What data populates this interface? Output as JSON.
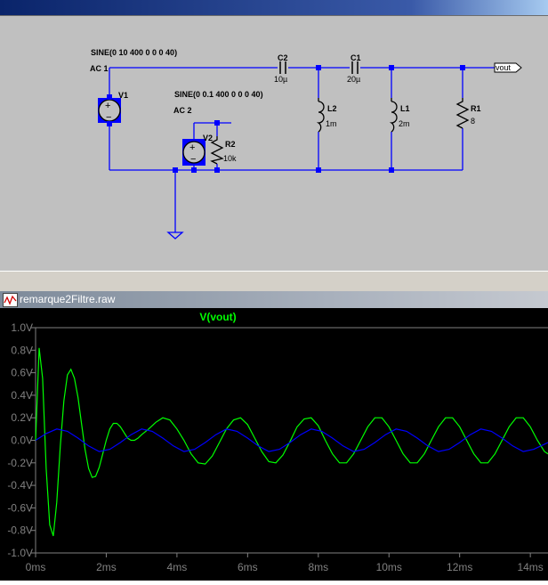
{
  "schematic": {
    "v1": {
      "name": "V1",
      "source": "SINE(0 10 400 0 0 0 40)",
      "ac": "AC 1"
    },
    "v2": {
      "name": "V2",
      "source": "SINE(0 0.1 400 0 0 0 40)",
      "ac": "AC 2"
    },
    "c2": {
      "name": "C2",
      "value": "10µ"
    },
    "c1": {
      "name": "C1",
      "value": "20µ"
    },
    "l2": {
      "name": "L2",
      "value": "1m"
    },
    "l1": {
      "name": "L1",
      "value": "2m"
    },
    "r1": {
      "name": "R1",
      "value": "8"
    },
    "r2": {
      "name": "R2",
      "value": "10k"
    },
    "net_label": "vout"
  },
  "plot_window": {
    "title": "remarque2Filtre.raw"
  },
  "chart_data": {
    "type": "line",
    "title": "",
    "xlabel": "",
    "ylabel": "",
    "x_unit": "ms",
    "xlim": [
      0,
      14.5
    ],
    "ylim": [
      -1.0,
      1.0
    ],
    "x_ticks": [
      "0ms",
      "2ms",
      "4ms",
      "6ms",
      "8ms",
      "10ms",
      "12ms",
      "14ms"
    ],
    "y_ticks": [
      "1.0V",
      "0.8V",
      "0.6V",
      "0.4V",
      "0.2V",
      "0.0V",
      "-0.2V",
      "-0.4V",
      "-0.6V",
      "-0.8V",
      "-1.0V"
    ],
    "series": [
      {
        "name": "V(vout)",
        "color": "#00ff00",
        "x": [
          0,
          0.1,
          0.2,
          0.3,
          0.4,
          0.5,
          0.6,
          0.7,
          0.8,
          0.9,
          1.0,
          1.1,
          1.2,
          1.3,
          1.4,
          1.5,
          1.6,
          1.7,
          1.8,
          1.9,
          2.0,
          2.1,
          2.2,
          2.3,
          2.4,
          2.5,
          2.6,
          2.7,
          2.8,
          2.9,
          3.0,
          3.2,
          3.4,
          3.6,
          3.8,
          4.0,
          4.2,
          4.4,
          4.6,
          4.8,
          5.0,
          5.2,
          5.4,
          5.6,
          5.8,
          6.0,
          6.2,
          6.4,
          6.6,
          6.8,
          7.0,
          7.2,
          7.4,
          7.6,
          7.8,
          8.0,
          8.2,
          8.4,
          8.6,
          8.8,
          9.0,
          9.2,
          9.4,
          9.6,
          9.8,
          10.0,
          10.2,
          10.4,
          10.6,
          10.8,
          11.0,
          11.2,
          11.4,
          11.6,
          11.8,
          12.0,
          12.2,
          12.4,
          12.6,
          12.8,
          13.0,
          13.2,
          13.4,
          13.6,
          13.8,
          14.0,
          14.2,
          14.4,
          14.5
        ],
        "y": [
          0.0,
          0.82,
          0.55,
          -0.25,
          -0.75,
          -0.85,
          -0.55,
          -0.05,
          0.35,
          0.58,
          0.63,
          0.55,
          0.38,
          0.15,
          -0.08,
          -0.25,
          -0.33,
          -0.32,
          -0.24,
          -0.12,
          0.0,
          0.1,
          0.15,
          0.15,
          0.12,
          0.07,
          0.02,
          0.0,
          0.0,
          0.02,
          0.05,
          0.1,
          0.16,
          0.2,
          0.18,
          0.1,
          0.0,
          -0.12,
          -0.2,
          -0.21,
          -0.14,
          -0.02,
          0.1,
          0.18,
          0.2,
          0.14,
          0.02,
          -0.1,
          -0.19,
          -0.2,
          -0.13,
          -0.01,
          0.12,
          0.19,
          0.2,
          0.13,
          0.0,
          -0.12,
          -0.2,
          -0.2,
          -0.12,
          0.0,
          0.12,
          0.2,
          0.2,
          0.12,
          0.0,
          -0.12,
          -0.2,
          -0.2,
          -0.12,
          0.0,
          0.12,
          0.2,
          0.2,
          0.12,
          0.0,
          -0.12,
          -0.2,
          -0.2,
          -0.12,
          0.0,
          0.12,
          0.2,
          0.2,
          0.12,
          0.0,
          -0.1,
          -0.12
        ]
      },
      {
        "name": "",
        "color": "#0000ff",
        "x": [
          0,
          0.3,
          0.6,
          0.9,
          1.2,
          1.5,
          1.8,
          2.1,
          2.4,
          2.7,
          3.0,
          3.3,
          3.6,
          3.9,
          4.2,
          4.5,
          4.8,
          5.1,
          5.4,
          5.7,
          6.0,
          6.3,
          6.6,
          6.9,
          7.2,
          7.5,
          7.8,
          8.1,
          8.4,
          8.7,
          9.0,
          9.3,
          9.6,
          9.9,
          10.2,
          10.5,
          10.8,
          11.1,
          11.4,
          11.7,
          12.0,
          12.3,
          12.6,
          12.9,
          13.2,
          13.5,
          13.8,
          14.1,
          14.5
        ],
        "y": [
          0.0,
          0.06,
          0.1,
          0.08,
          0.02,
          -0.05,
          -0.1,
          -0.08,
          -0.02,
          0.05,
          0.1,
          0.08,
          0.02,
          -0.05,
          -0.1,
          -0.08,
          -0.02,
          0.05,
          0.1,
          0.08,
          0.02,
          -0.05,
          -0.1,
          -0.08,
          -0.02,
          0.05,
          0.1,
          0.08,
          0.02,
          -0.05,
          -0.1,
          -0.08,
          -0.02,
          0.05,
          0.1,
          0.08,
          0.02,
          -0.05,
          -0.1,
          -0.08,
          -0.02,
          0.05,
          0.1,
          0.08,
          0.02,
          -0.05,
          -0.1,
          -0.08,
          -0.02
        ]
      }
    ],
    "grid": false,
    "legend": "top-center"
  }
}
